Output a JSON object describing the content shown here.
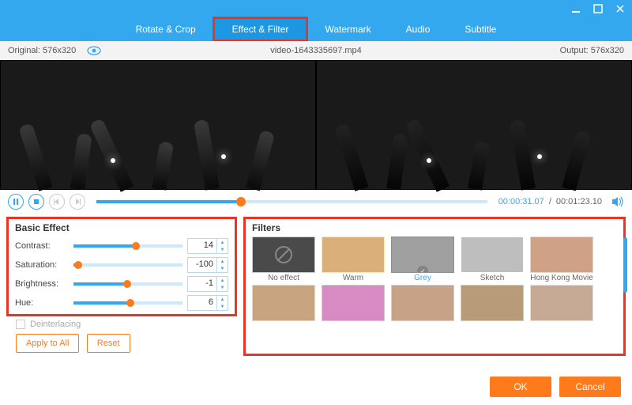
{
  "tabs": {
    "rotate": "Rotate & Crop",
    "effect": "Effect & Filter",
    "watermark": "Watermark",
    "audio": "Audio",
    "subtitle": "Subtitle"
  },
  "info": {
    "original_label": "Original: 576x320",
    "filename": "video-1643335697.mp4",
    "output_label": "Output: 576x320"
  },
  "transport": {
    "current": "00:00:31.07",
    "sep": "/",
    "total": "00:01:23.10",
    "progress_pct": 37
  },
  "basic": {
    "title": "Basic Effect",
    "contrast": {
      "label": "Contrast:",
      "value": "14",
      "pct": 57
    },
    "saturation": {
      "label": "Saturation:",
      "value": "-100",
      "pct": 4
    },
    "brightness": {
      "label": "Brightness:",
      "value": "-1",
      "pct": 49
    },
    "hue": {
      "label": "Hue:",
      "value": "6",
      "pct": 52
    }
  },
  "deinterlace_label": "Deinterlacing",
  "buttons": {
    "apply_all": "Apply to All",
    "reset": "Reset",
    "ok": "OK",
    "cancel": "Cancel"
  },
  "filters": {
    "title": "Filters",
    "items": [
      {
        "label": "No effect"
      },
      {
        "label": "Warm"
      },
      {
        "label": "Grey"
      },
      {
        "label": "Sketch"
      },
      {
        "label": "Hong Kong Movie"
      }
    ],
    "selected_index": 2
  }
}
